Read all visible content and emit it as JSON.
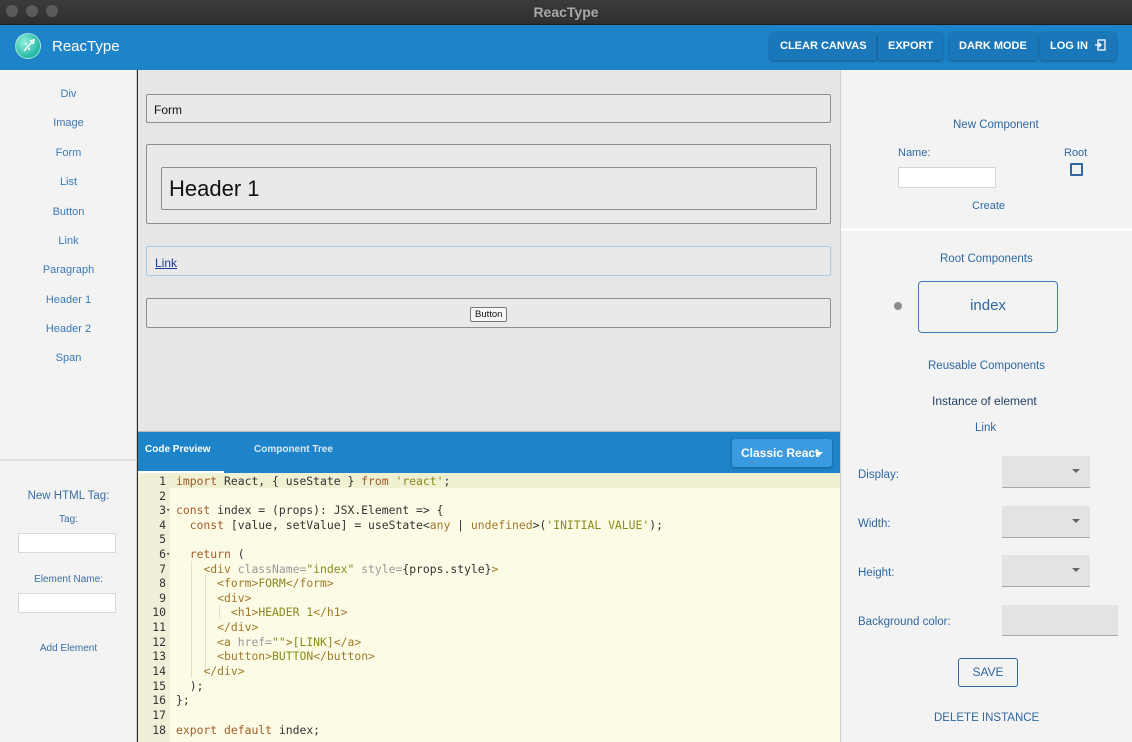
{
  "window": {
    "title": "ReacType"
  },
  "appbar": {
    "brand": "ReacType",
    "buttons": {
      "clear": "CLEAR CANVAS",
      "export": "EXPORT",
      "dark": "DARK MODE",
      "login": "LOG IN"
    }
  },
  "left": {
    "components": [
      "Div",
      "Image",
      "Form",
      "List",
      "Button",
      "Link",
      "Paragraph",
      "Header 1",
      "Header 2",
      "Span"
    ],
    "new_tag": {
      "heading": "New HTML Tag:",
      "tag_label": "Tag:",
      "tag_value": "",
      "element_label": "Element Name:",
      "element_value": "",
      "add": "Add Element"
    }
  },
  "canvas": {
    "form": "Form",
    "header": "Header 1",
    "link": "Link",
    "button": "Button"
  },
  "codebar": {
    "tab_code": "Code Preview",
    "tab_tree": "Component Tree",
    "mode": "Classic React"
  },
  "editor": {
    "line_numbers": [
      "1",
      "2",
      "3",
      "4",
      "5",
      "6",
      "7",
      "8",
      "9",
      "10",
      "11",
      "12",
      "13",
      "14",
      "15",
      "16",
      "17",
      "18"
    ],
    "lines": [
      "import React, { useState } from 'react';",
      "",
      "const index = (props): JSX.Element => {",
      "  const [value, setValue] = useState<any | undefined>('INITIAL VALUE');",
      "",
      "  return (",
      "    <div className=\"index\" style={props.style}>",
      "      <form>FORM</form>",
      "      <div>",
      "        <h1>HEADER 1</h1>",
      "      </div>",
      "      <a href=\"\">[LINK]</a>",
      "      <button>BUTTON</button>",
      "    </div>",
      "  );",
      "};",
      "",
      "export default index;"
    ]
  },
  "right": {
    "new_component": "New Component",
    "name_label": "Name:",
    "name_value": "",
    "root_label": "Root",
    "create": "Create",
    "root_components": "Root Components",
    "index_card": "index",
    "reusable": "Reusable Components",
    "instance": "Instance of element",
    "instance_name": "Link",
    "fields": {
      "display": "Display:",
      "width": "Width:",
      "height": "Height:",
      "bg": "Background color:"
    },
    "save": "SAVE",
    "delete": "DELETE INSTANCE"
  }
}
